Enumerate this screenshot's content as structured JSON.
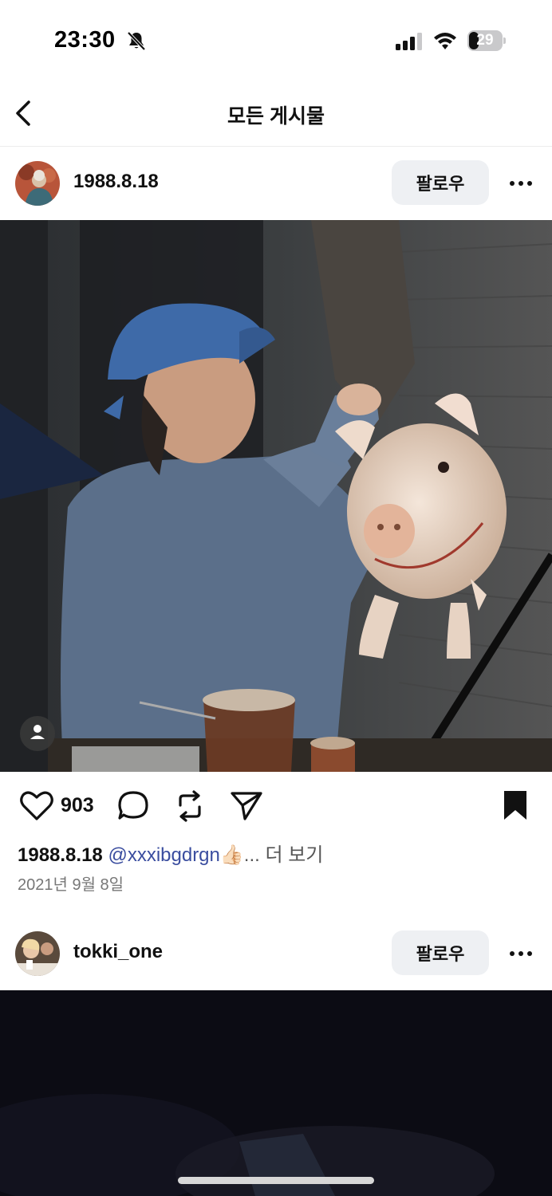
{
  "status_bar": {
    "time": "23:30",
    "battery": "29"
  },
  "nav": {
    "title": "모든 게시물"
  },
  "posts": [
    {
      "username": "1988.8.18",
      "follow_label": "팔로우",
      "likes": "903",
      "caption_user": "1988.8.18",
      "caption_mention": "@xxxibgdrgn",
      "caption_emoji": "👍🏻",
      "caption_more": "... 더 보기",
      "date": "2021년 9월 8일"
    },
    {
      "username": "tokki_one",
      "follow_label": "팔로우"
    }
  ],
  "icons": [
    "bell-off-icon",
    "signal-icon",
    "wifi-icon",
    "battery-icon",
    "back-chevron-icon",
    "more-icon",
    "heart-icon",
    "comment-icon",
    "repost-icon",
    "send-icon",
    "bookmark-icon",
    "person-tag-icon"
  ],
  "colors": {
    "mention": "#3a4d9f",
    "follow_bg": "#eef0f3",
    "text": "#111111"
  }
}
